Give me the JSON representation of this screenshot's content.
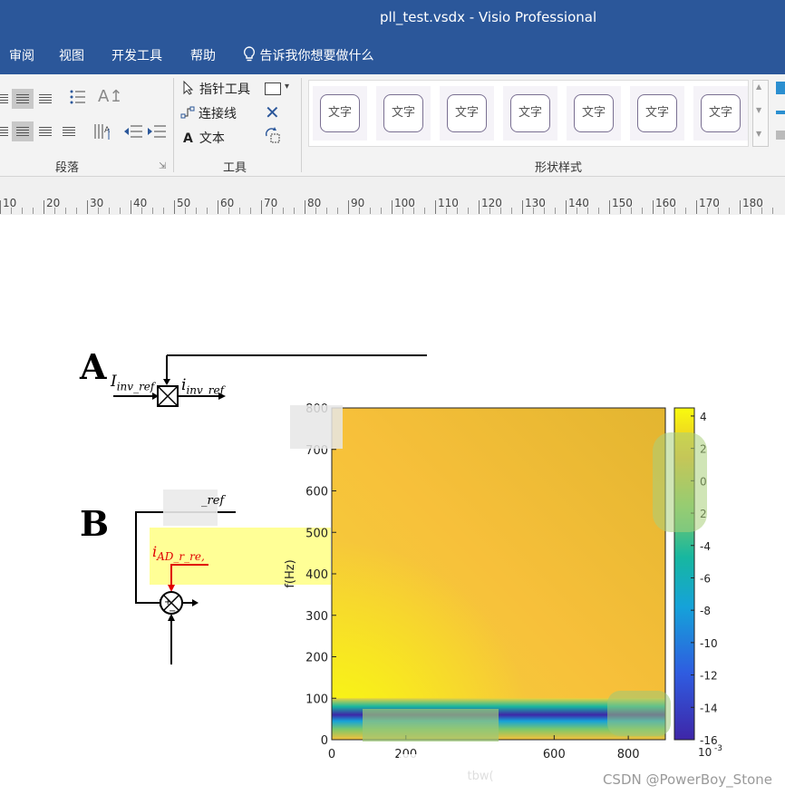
{
  "window": {
    "title": "pll_test.vsdx  -  Visio Professional"
  },
  "menu": {
    "items": [
      "审阅",
      "视图",
      "开发工具",
      "帮助"
    ],
    "tell_me": "告诉我你想要做什么"
  },
  "ribbon": {
    "groups": {
      "paragraph": "段落",
      "tools": "工具",
      "shape_styles": "形状样式"
    },
    "tools": {
      "pointer": "指针工具",
      "connector": "连接线",
      "text": "文本"
    },
    "style_cells": [
      "文字",
      "文字",
      "文字",
      "文字",
      "文字",
      "文字",
      "文字"
    ]
  },
  "ruler": {
    "labels": [
      "10",
      "20",
      "30",
      "40",
      "50",
      "60",
      "70",
      "80",
      "90",
      "100",
      "110",
      "120",
      "130",
      "140",
      "150",
      "160",
      "170",
      "180"
    ]
  },
  "diagram": {
    "label_a": "A",
    "label_b": "B",
    "a_in_main": "I",
    "a_in_sub": "inv_ref",
    "a_out_main": "i",
    "a_out_sub": "inv_ref",
    "b_ref": "_ref",
    "b_ad_main": "i",
    "b_ad_sub": "AD_r_re,"
  },
  "chart_data": {
    "type": "heatmap",
    "xlabel": "tbw(",
    "ylabel": "f(Hz)",
    "x_ticks": [
      "0",
      "200",
      "600",
      "800"
    ],
    "y_ticks": [
      "0",
      "100",
      "200",
      "300",
      "400",
      "500",
      "600",
      "700",
      "800"
    ],
    "xlim": [
      0,
      900
    ],
    "ylim": [
      0,
      800
    ],
    "colorbar": {
      "ticks": [
        "4",
        "2",
        "0",
        "2",
        "-4",
        "-6",
        "-8",
        "-10",
        "-12",
        "-14",
        "-16"
      ],
      "range": [
        -16,
        4.5
      ],
      "exponent": "10",
      "exponent_power": "-3"
    },
    "colors": {
      "high": "#f9fb0e",
      "mid": "#f7c03a",
      "low": "#3e26a8",
      "teal": "#17b7a0"
    }
  },
  "watermark": "CSDN @PowerBoy_Stone"
}
